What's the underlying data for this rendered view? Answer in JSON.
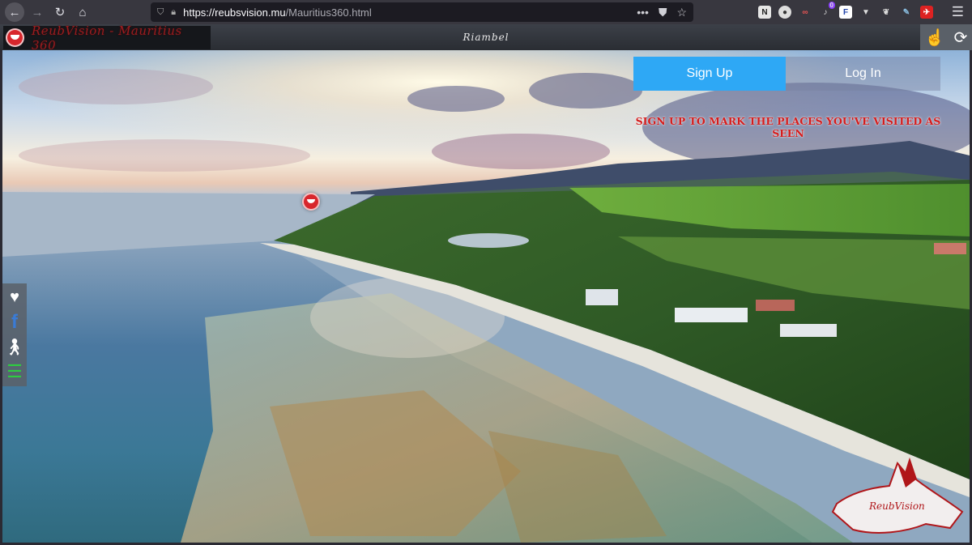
{
  "browser": {
    "url_host": "https://reubsvision.mu",
    "url_path": "/Mauritius360.html",
    "notification_count": "0"
  },
  "site": {
    "brand": "ReubVision - Mauritius 360",
    "location": "Riambel"
  },
  "auth": {
    "signup_label": "Sign Up",
    "login_label": "Log In",
    "promo": "SIGN UP TO MARK THE PLACES YOU'VE VISITED AS SEEN",
    "active_tab_color": "#2ea8f5"
  },
  "sidebar": {
    "icons": [
      "heart-icon",
      "facebook-icon",
      "person-icon",
      "menu-icon"
    ]
  },
  "watermark": {
    "text": "ReubVision"
  },
  "colors": {
    "brand_red": "#d8262c",
    "promo_red": "#d41c1c"
  }
}
